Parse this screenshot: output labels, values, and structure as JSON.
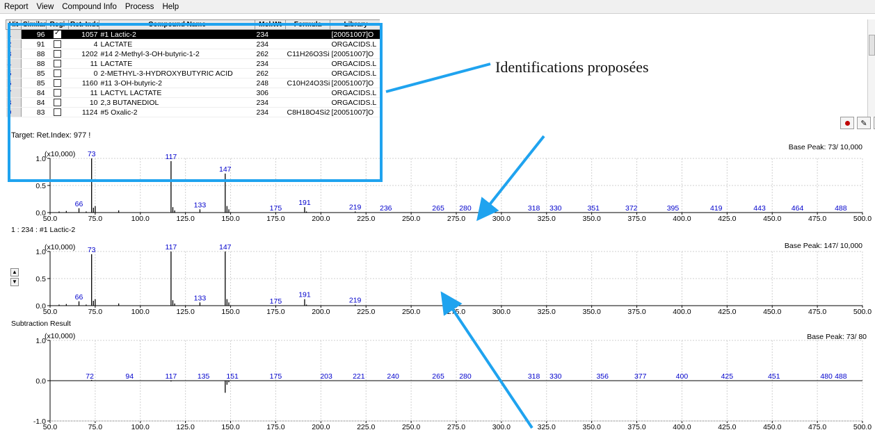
{
  "menu": [
    "Report",
    "View",
    "Compound Info",
    "Process",
    "Help"
  ],
  "table": {
    "headers": [
      "Hit",
      "Similar",
      "Regi",
      "Ret. Index",
      "Compound Name",
      "Mol.Wt",
      "Formula",
      "Library"
    ],
    "rows": [
      {
        "hit": "1",
        "sim": "96",
        "checked": true,
        "ri": "1057",
        "name": "#1 Lactic-2",
        "mw": "234",
        "formula": "",
        "lib": "[20051007]O",
        "selected": true
      },
      {
        "hit": "2",
        "sim": "91",
        "checked": false,
        "ri": "4",
        "name": "LACTATE",
        "mw": "234",
        "formula": "",
        "lib": "ORGACIDS.L",
        "selected": false
      },
      {
        "hit": "3",
        "sim": "88",
        "checked": false,
        "ri": "1202",
        "name": "#14 2-Methyl-3-OH-butyric-1-2",
        "mw": "262",
        "formula": "C11H26O3Si",
        "lib": "[20051007]O",
        "selected": false
      },
      {
        "hit": "4",
        "sim": "88",
        "checked": false,
        "ri": "11",
        "name": "LACTATE",
        "mw": "234",
        "formula": "",
        "lib": "ORGACIDS.L",
        "selected": false
      },
      {
        "hit": "5",
        "sim": "85",
        "checked": false,
        "ri": "0",
        "name": "2-METHYL-3-HYDROXYBUTYRIC ACID",
        "mw": "262",
        "formula": "",
        "lib": "ORGACIDS.L",
        "selected": false
      },
      {
        "hit": "6",
        "sim": "85",
        "checked": false,
        "ri": "1160",
        "name": "#11 3-OH-butyric-2",
        "mw": "248",
        "formula": "C10H24O3Si",
        "lib": "[20051007]O",
        "selected": false
      },
      {
        "hit": "7",
        "sim": "84",
        "checked": false,
        "ri": "11",
        "name": "LACTYL LACTATE",
        "mw": "306",
        "formula": "",
        "lib": "ORGACIDS.L",
        "selected": false
      },
      {
        "hit": "8",
        "sim": "84",
        "checked": false,
        "ri": "10",
        "name": "2,3 BUTANEDIOL",
        "mw": "234",
        "formula": "",
        "lib": "ORGACIDS.L",
        "selected": false
      },
      {
        "hit": "9",
        "sim": "83",
        "checked": false,
        "ri": "1124",
        "name": "#5 Oxalic-2",
        "mw": "234",
        "formula": "C8H18O4Si2",
        "lib": "[20051007]O",
        "selected": false
      }
    ]
  },
  "target_text": "Target:    Ret.Index:    977 !",
  "annotation_text": "Identifications proposées",
  "colors": {
    "accent": "#1fa3ef",
    "peak_label": "#0000cc"
  },
  "chart_data": [
    {
      "type": "bar",
      "title": "",
      "scale_label": "(x10,000)",
      "base_peak": "Base Peak: 73/ 10,000",
      "xlim": [
        50,
        500
      ],
      "ylim": [
        0,
        1
      ],
      "xticks": [
        50,
        75,
        100,
        125,
        150,
        175,
        200,
        225,
        250,
        275,
        300,
        325,
        350,
        375,
        400,
        425,
        450,
        475,
        500
      ],
      "x_tick_labels": [
        "50.0",
        "75.0",
        "100.0",
        "125.0",
        "150.0",
        "175.0",
        "200.0",
        "225.0",
        "250.0",
        "275.0",
        "300.0",
        "325.0",
        "350.0",
        "375.0",
        "400.0",
        "425.0",
        "450.0",
        "475.0",
        "500.0"
      ],
      "yticks": [
        0,
        0.5,
        1
      ],
      "y_tick_labels": [
        "0.0",
        "0.5",
        "1.0"
      ],
      "peaks": [
        [
          55,
          0.02
        ],
        [
          59,
          0.03
        ],
        [
          66,
          0.08
        ],
        [
          70,
          0.02
        ],
        [
          73,
          1.0
        ],
        [
          74,
          0.09
        ],
        [
          75,
          0.12
        ],
        [
          88,
          0.04
        ],
        [
          117,
          0.95
        ],
        [
          118,
          0.1
        ],
        [
          119,
          0.04
        ],
        [
          133,
          0.06
        ],
        [
          147,
          0.72
        ],
        [
          148,
          0.12
        ],
        [
          149,
          0.06
        ],
        [
          191,
          0.1
        ],
        [
          192,
          0.02
        ],
        [
          219,
          0.02
        ]
      ],
      "peak_labels": [
        {
          "x": 66,
          "y": 0.08,
          "text": "66"
        },
        {
          "x": 73,
          "y": 1.0,
          "text": "73"
        },
        {
          "x": 117,
          "y": 0.95,
          "text": "117"
        },
        {
          "x": 133,
          "y": 0.06,
          "text": "133"
        },
        {
          "x": 147,
          "y": 0.72,
          "text": "147"
        },
        {
          "x": 175,
          "y": 0.0,
          "text": "175"
        },
        {
          "x": 191,
          "y": 0.1,
          "text": "191"
        },
        {
          "x": 219,
          "y": 0.02,
          "text": "219"
        },
        {
          "x": 236,
          "y": 0.0,
          "text": "236"
        },
        {
          "x": 265,
          "y": 0.0,
          "text": "265"
        },
        {
          "x": 280,
          "y": 0.0,
          "text": "280"
        },
        {
          "x": 318,
          "y": 0.0,
          "text": "318"
        },
        {
          "x": 330,
          "y": 0.0,
          "text": "330"
        },
        {
          "x": 351,
          "y": 0.0,
          "text": "351"
        },
        {
          "x": 372,
          "y": 0.0,
          "text": "372"
        },
        {
          "x": 395,
          "y": 0.0,
          "text": "395"
        },
        {
          "x": 419,
          "y": 0.0,
          "text": "419"
        },
        {
          "x": 443,
          "y": 0.0,
          "text": "443"
        },
        {
          "x": 464,
          "y": 0.0,
          "text": "464"
        },
        {
          "x": 488,
          "y": 0.0,
          "text": "488"
        }
      ]
    },
    {
      "type": "bar",
      "title": "1 : 234 : #1 Lactic-2",
      "scale_label": "(x10,000)",
      "base_peak": "Base Peak: 147/ 10,000",
      "xlim": [
        50,
        500
      ],
      "ylim": [
        0,
        1
      ],
      "xticks": [
        50,
        75,
        100,
        125,
        150,
        175,
        200,
        225,
        250,
        275,
        300,
        325,
        350,
        375,
        400,
        425,
        450,
        475,
        500
      ],
      "x_tick_labels": [
        "50.0",
        "75.0",
        "100.0",
        "125.0",
        "150.0",
        "175.0",
        "200.0",
        "225.0",
        "250.0",
        "275.0",
        "300.0",
        "325.0",
        "350.0",
        "375.0",
        "400.0",
        "425.0",
        "450.0",
        "475.0",
        "500.0"
      ],
      "yticks": [
        0,
        0.5,
        1
      ],
      "y_tick_labels": [
        "0.0",
        "0.5",
        "1.0"
      ],
      "peaks": [
        [
          55,
          0.02
        ],
        [
          59,
          0.03
        ],
        [
          66,
          0.08
        ],
        [
          70,
          0.02
        ],
        [
          73,
          0.95
        ],
        [
          74,
          0.09
        ],
        [
          75,
          0.12
        ],
        [
          88,
          0.04
        ],
        [
          117,
          1.0
        ],
        [
          118,
          0.1
        ],
        [
          119,
          0.04
        ],
        [
          133,
          0.06
        ],
        [
          147,
          1.0
        ],
        [
          148,
          0.12
        ],
        [
          149,
          0.06
        ],
        [
          191,
          0.12
        ],
        [
          192,
          0.02
        ],
        [
          219,
          0.02
        ]
      ],
      "peak_labels": [
        {
          "x": 66,
          "y": 0.08,
          "text": "66"
        },
        {
          "x": 73,
          "y": 0.95,
          "text": "73"
        },
        {
          "x": 117,
          "y": 1.0,
          "text": "117"
        },
        {
          "x": 133,
          "y": 0.06,
          "text": "133"
        },
        {
          "x": 147,
          "y": 1.0,
          "text": "147"
        },
        {
          "x": 175,
          "y": 0.0,
          "text": "175"
        },
        {
          "x": 191,
          "y": 0.12,
          "text": "191"
        },
        {
          "x": 219,
          "y": 0.02,
          "text": "219"
        }
      ]
    },
    {
      "type": "bar",
      "title": "Subtraction Result",
      "scale_label": "(x10,000)",
      "base_peak": "Base Peak: 73/   80",
      "xlim": [
        50,
        500
      ],
      "ylim": [
        -1,
        1
      ],
      "xticks": [
        50,
        75,
        100,
        125,
        150,
        175,
        200,
        225,
        250,
        275,
        300,
        325,
        350,
        375,
        400,
        425,
        450,
        475,
        500
      ],
      "x_tick_labels": [
        "50.0",
        "75.0",
        "100.0",
        "125.0",
        "150.0",
        "175.0",
        "200.0",
        "225.0",
        "250.0",
        "275.0",
        "300.0",
        "325.0",
        "350.0",
        "375.0",
        "400.0",
        "425.0",
        "450.0",
        "475.0",
        "500.0"
      ],
      "yticks": [
        -1,
        0,
        1
      ],
      "y_tick_labels": [
        "-1.0",
        "0.0",
        "1.0"
      ],
      "peaks": [
        [
          73,
          0.02
        ],
        [
          117,
          -0.02
        ],
        [
          147,
          -0.3
        ],
        [
          148,
          -0.1
        ],
        [
          149,
          -0.04
        ]
      ],
      "peak_labels": [
        {
          "x": 72,
          "y": 0.0,
          "text": "72"
        },
        {
          "x": 94,
          "y": 0.0,
          "text": "94"
        },
        {
          "x": 117,
          "y": -0.05,
          "text": "117"
        },
        {
          "x": 135,
          "y": 0.0,
          "text": "135"
        },
        {
          "x": 151,
          "y": 0.0,
          "text": "151"
        },
        {
          "x": 175,
          "y": 0.0,
          "text": "175"
        },
        {
          "x": 203,
          "y": 0.0,
          "text": "203"
        },
        {
          "x": 221,
          "y": 0.0,
          "text": "221"
        },
        {
          "x": 240,
          "y": 0.0,
          "text": "240"
        },
        {
          "x": 265,
          "y": 0.0,
          "text": "265"
        },
        {
          "x": 280,
          "y": 0.0,
          "text": "280"
        },
        {
          "x": 318,
          "y": 0.0,
          "text": "318"
        },
        {
          "x": 330,
          "y": 0.0,
          "text": "330"
        },
        {
          "x": 356,
          "y": 0.0,
          "text": "356"
        },
        {
          "x": 377,
          "y": 0.0,
          "text": "377"
        },
        {
          "x": 400,
          "y": 0.0,
          "text": "400"
        },
        {
          "x": 425,
          "y": 0.0,
          "text": "425"
        },
        {
          "x": 451,
          "y": 0.0,
          "text": "451"
        },
        {
          "x": 480,
          "y": 0.0,
          "text": "480"
        },
        {
          "x": 488,
          "y": 0.0,
          "text": "488"
        }
      ]
    }
  ]
}
